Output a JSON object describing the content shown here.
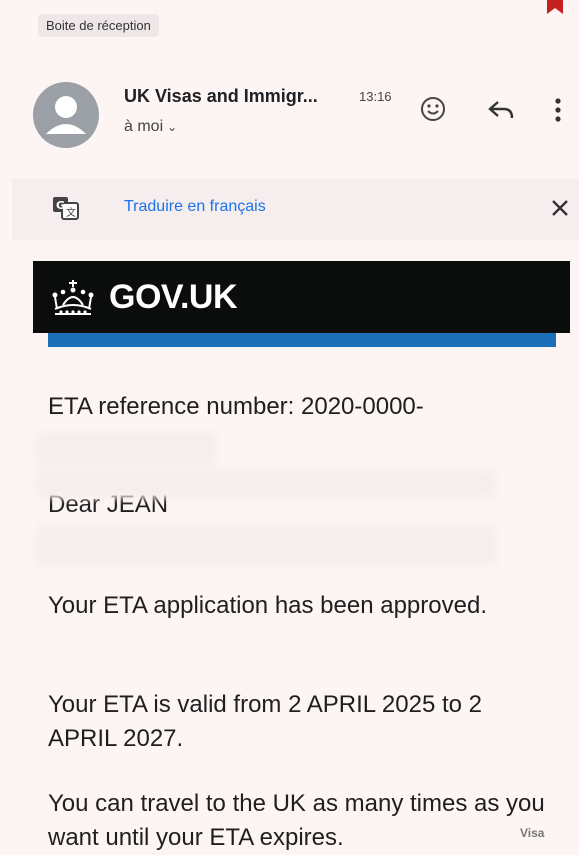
{
  "mailbox": {
    "label": "Boite de réception"
  },
  "message": {
    "sender": "UK Visas and Immigr...",
    "time": "13:16",
    "recipient": "à moi"
  },
  "translate": {
    "link": "Traduire en français"
  },
  "email_body": {
    "header_title": "GOV.UK",
    "reference": "ETA reference number: 2020-0000-",
    "greeting": "Dear JEAN",
    "approved": "Your ETA application has been approved.",
    "validity": "Your ETA is valid from 2 APRIL 2025 to 2 APRIL 2027.",
    "travel": "You can travel to the UK as many times as you want until your ETA expires."
  },
  "watermark": "Visa",
  "colors": {
    "background": "#fdf4f4",
    "gov_black": "#0b0c0c",
    "gov_blue": "#1d70b8",
    "link_blue": "#1a73e8",
    "bookmark": "#c5221f"
  },
  "icons": [
    "bookmark-icon",
    "avatar-icon",
    "chevron-down-icon",
    "emoji-icon",
    "reply-icon",
    "more-vert-icon",
    "translate-icon",
    "close-icon",
    "crown-icon"
  ]
}
